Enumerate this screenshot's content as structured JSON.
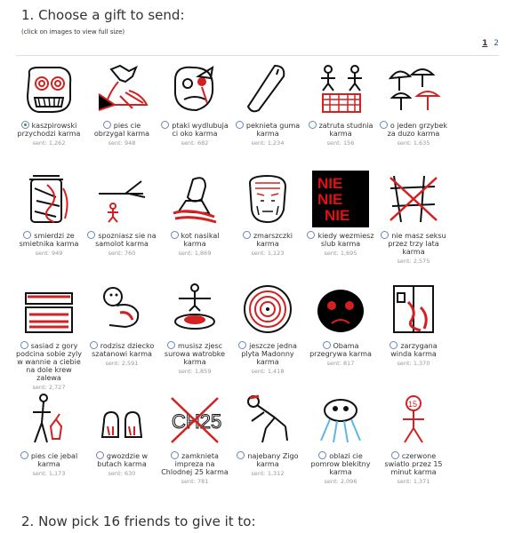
{
  "step1_title": "1. Choose a gift to send:",
  "note": "(click on images to view full size)",
  "pager": {
    "current": "1",
    "next": "2"
  },
  "gifts": [
    {
      "label": "kaszpirowski przychodzi karma",
      "sent": "sent: 1,262",
      "selected": true,
      "icon": "screaming-face-icon"
    },
    {
      "label": "pies cie obrzygal karma",
      "sent": "sent: 948",
      "selected": false,
      "icon": "vomiting-dog-icon"
    },
    {
      "label": "ptaki wydlubuja ci oko karma",
      "sent": "sent: 682",
      "selected": false,
      "icon": "bird-eye-face-icon"
    },
    {
      "label": "peknieta guma karma",
      "sent": "sent: 1,234",
      "selected": false,
      "icon": "condom-icon"
    },
    {
      "label": "zatruta studnia karma",
      "sent": "sent: 156",
      "selected": false,
      "icon": "well-icon"
    },
    {
      "label": "o jeden grzybek za duzo karma",
      "sent": "sent: 1,635",
      "selected": false,
      "icon": "mushrooms-icon"
    },
    {
      "label": "smierdzi ze smietnika karma",
      "sent": "sent: 949",
      "selected": false,
      "icon": "trash-can-icon"
    },
    {
      "label": "spozniasz sie na samolot karma",
      "sent": "sent: 760",
      "selected": false,
      "icon": "airplane-icon"
    },
    {
      "label": "kot nasikal karma",
      "sent": "sent: 1,869",
      "selected": false,
      "icon": "cat-icon"
    },
    {
      "label": "zmarszczki karma",
      "sent": "sent: 1,123",
      "selected": false,
      "icon": "wrinkled-face-icon"
    },
    {
      "label": "kiedy wezmiesz slub karma",
      "sent": "sent: 1,695",
      "selected": false,
      "icon": "nie-nie-nie-icon",
      "nie": [
        "NIE",
        "NIE",
        "NIE"
      ]
    },
    {
      "label": "nie masz seksu przez trzy lata karma",
      "sent": "sent: 2,575",
      "selected": false,
      "icon": "crossed-figure-icon"
    },
    {
      "label": "sasiad z gory podcina sobie zyly w wannie a ciebie na dole krew zalewa",
      "sent": "sent: 2,727",
      "selected": false,
      "icon": "bathtub-icon"
    },
    {
      "label": "rodzisz dziecko szatanowi karma",
      "sent": "sent: 2,591",
      "selected": false,
      "icon": "baby-icon"
    },
    {
      "label": "musisz zjesc surowa watrobke karma",
      "sent": "sent: 1,859",
      "selected": false,
      "icon": "liver-plate-icon"
    },
    {
      "label": "jeszcze jedna plyta Madonny karma",
      "sent": "sent: 1,418",
      "selected": false,
      "icon": "record-icon"
    },
    {
      "label": "Obama przegrywa karma",
      "sent": "sent: 817",
      "selected": false,
      "icon": "sad-face-icon"
    },
    {
      "label": "zarzygana winda karma",
      "sent": "sent: 1,370",
      "selected": false,
      "icon": "elevator-icon"
    },
    {
      "label": "pies cie jebal karma",
      "sent": "sent: 1,173",
      "selected": false,
      "icon": "dog-man-icon"
    },
    {
      "label": "gwozdzie w butach karma",
      "sent": "sent: 630",
      "selected": false,
      "icon": "feet-icon"
    },
    {
      "label": "zamknieta impreza na Chlodnej 25 karma",
      "sent": "sent: 781",
      "selected": false,
      "icon": "crossed-ch25-icon",
      "text": "CH25"
    },
    {
      "label": "najebany Zigo karma",
      "sent": "sent: 1,312",
      "selected": false,
      "icon": "crawling-man-icon"
    },
    {
      "label": "oblazi cie pomrow blekitny karma",
      "sent": "sent: 2,096",
      "selected": false,
      "icon": "slug-icon"
    },
    {
      "label": "czerwone swiatlo przez 15 minut karma",
      "sent": "sent: 1,371",
      "selected": false,
      "icon": "red-man-icon",
      "text": "15"
    }
  ],
  "step2_title": "2. Now pick 16 friends to give it to:",
  "colors": {
    "accent": "#3b5998",
    "red": "#d42020",
    "ink": "#111111"
  }
}
